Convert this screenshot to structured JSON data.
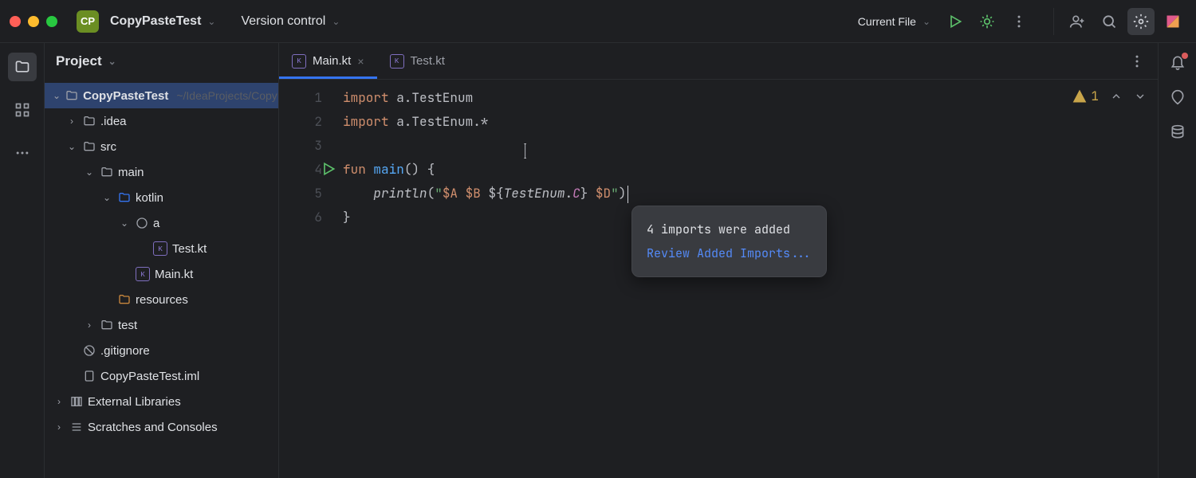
{
  "colors": {
    "accent": "#3574f0",
    "run": "#5cbf6a",
    "warn": "#c9a54a"
  },
  "titlebar": {
    "traffic": [
      "#ff5f57",
      "#febc2e",
      "#28c840"
    ],
    "project_badge": "CP",
    "project_name": "CopyPasteTest",
    "vcs_label": "Version control",
    "run_config": "Current File"
  },
  "sidebar_left": [
    "project",
    "structure",
    "more"
  ],
  "sidebar_right": [
    "notifications",
    "ai",
    "database"
  ],
  "project_tool": {
    "title": "Project",
    "tree": [
      {
        "d": 0,
        "exp": "open",
        "icon": "dir",
        "label": "CopyPasteTest",
        "bold": true,
        "path": "~/IdeaProjects/CopyPasteTest",
        "sel": true
      },
      {
        "d": 1,
        "exp": "closed",
        "icon": "dir",
        "label": ".idea"
      },
      {
        "d": 1,
        "exp": "open",
        "icon": "dir",
        "label": "src"
      },
      {
        "d": 2,
        "exp": "open",
        "icon": "dir",
        "label": "main"
      },
      {
        "d": 3,
        "exp": "open",
        "icon": "dir-src",
        "label": "kotlin"
      },
      {
        "d": 4,
        "exp": "open",
        "icon": "pkg",
        "label": "a"
      },
      {
        "d": 5,
        "exp": "",
        "icon": "kt",
        "label": "Test.kt"
      },
      {
        "d": 4,
        "exp": "",
        "icon": "kt",
        "label": "Main.kt"
      },
      {
        "d": 3,
        "exp": "",
        "icon": "res",
        "label": "resources"
      },
      {
        "d": 2,
        "exp": "closed",
        "icon": "dir",
        "label": "test"
      },
      {
        "d": 1,
        "exp": "",
        "icon": "ignore",
        "label": ".gitignore"
      },
      {
        "d": 1,
        "exp": "",
        "icon": "iml",
        "label": "CopyPasteTest.iml"
      },
      {
        "d": 0,
        "exp": "closed",
        "icon": "lib",
        "label": "External Libraries"
      },
      {
        "d": 0,
        "exp": "closed",
        "icon": "scratch",
        "label": "Scratches and Consoles"
      }
    ]
  },
  "editor": {
    "tabs": [
      {
        "label": "Main.kt",
        "icon": "kt",
        "active": true,
        "closable": true
      },
      {
        "label": "Test.kt",
        "icon": "kt",
        "active": false,
        "closable": false
      }
    ],
    "lines": [
      "import a.TestEnum",
      "import a.TestEnum.*",
      "",
      "fun main() {",
      "    println(\"$A $B ${TestEnum.C} $D\")",
      "}"
    ],
    "run_gutter_line": 4,
    "cursor_line": 5,
    "warnings": 1
  },
  "popup": {
    "message": "4 imports were added",
    "link": "Review Added Imports..."
  }
}
